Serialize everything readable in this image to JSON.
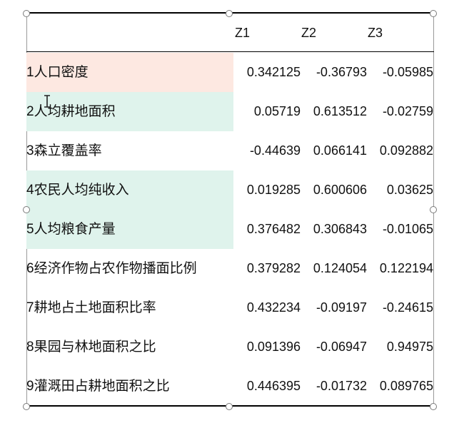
{
  "table": {
    "columns": [
      "Z1",
      "Z2",
      "Z3"
    ],
    "rows": [
      {
        "label": "1人口密度",
        "z1": "0.342125",
        "z2": "-0.36793",
        "z3": "-0.05985",
        "highlight": "#fde8e1"
      },
      {
        "label": "2人均耕地面积",
        "z1": "0.05719",
        "z2": "0.613512",
        "z3": "-0.02759",
        "highlight": "#dff3ec"
      },
      {
        "label": "3森立覆盖率",
        "z1": "-0.44639",
        "z2": "0.066141",
        "z3": "0.092882",
        "highlight": ""
      },
      {
        "label": "4农民人均纯收入",
        "z1": "0.019285",
        "z2": "0.600606",
        "z3": "0.03625",
        "highlight": "#dff3ec"
      },
      {
        "label": "5人均粮食产量",
        "z1": "0.376482",
        "z2": "0.306843",
        "z3": "-0.01065",
        "highlight": "#dff3ec"
      },
      {
        "label": "6经济作物占农作物播面比例",
        "z1": "0.379282",
        "z2": "0.124054",
        "z3": "0.122194",
        "highlight": ""
      },
      {
        "label": "7耕地占土地面积比率",
        "z1": "0.432234",
        "z2": "-0.09197",
        "z3": "-0.24615",
        "highlight": ""
      },
      {
        "label": "8果园与林地面积之比",
        "z1": "0.091396",
        "z2": "-0.06947",
        "z3": "0.94975",
        "highlight": ""
      },
      {
        "label": "9灌溉田占耕地面积之比",
        "z1": "0.446395",
        "z2": "-0.01732",
        "z3": "0.089765",
        "highlight": ""
      }
    ]
  },
  "icons": {
    "cursor": "text-cursor-icon",
    "handle": "resize-handle-icon"
  }
}
